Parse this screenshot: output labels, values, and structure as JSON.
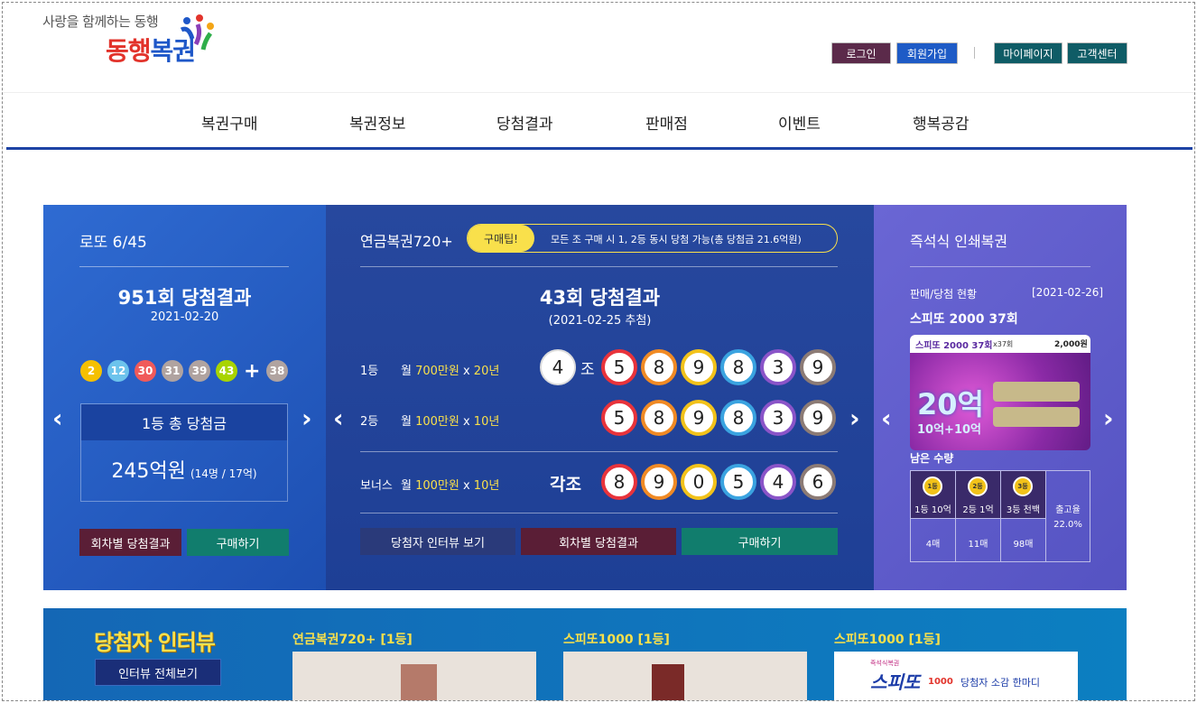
{
  "header": {
    "slogan": "사랑을 함께하는 동행",
    "logo_a": "동행",
    "logo_b": "복권",
    "buttons": [
      {
        "label": "로그인",
        "color": "#5b2a4a"
      },
      {
        "label": "회원가입",
        "color": "#1e5bc6"
      },
      {
        "label": "마이페이지",
        "color": "#0f5c66"
      },
      {
        "label": "고객센터",
        "color": "#0f5c66"
      }
    ]
  },
  "nav": [
    "복권구매",
    "복권정보",
    "당첨결과",
    "판매점",
    "이벤트",
    "행복공감"
  ],
  "lotto": {
    "title": "로또 6/45",
    "round": "951회 당첨결과",
    "date": "2021-02-20",
    "balls": [
      {
        "n": "2",
        "c": "#f5c000"
      },
      {
        "n": "12",
        "c": "#6cc3ec"
      },
      {
        "n": "30",
        "c": "#f05a5a"
      },
      {
        "n": "31",
        "c": "#b0a3a0"
      },
      {
        "n": "39",
        "c": "#b0a3a0"
      },
      {
        "n": "43",
        "c": "#a8d400"
      }
    ],
    "plus": "+",
    "bonus": {
      "n": "38",
      "c": "#b0a3a0"
    },
    "prize_label": "1등 총 당첨금",
    "prize": "245억원",
    "prize_sub": "(14명 / 17억)",
    "btn_results": "회차별 당첨결과",
    "btn_buy": "구매하기"
  },
  "pension": {
    "title": "연금복권720+",
    "tip_label": "구매팁!",
    "tip_text": "모든 조 구매 시 1, 2등 동시 당첨 가능(총 당첨금 21.6억원)",
    "round": "43회 당첨결과",
    "date": "(2021-02-25 추첨)",
    "rank1": {
      "label": "1등",
      "pre": "월 ",
      "amt": "700만원",
      "mid": " x ",
      "yrs": "20년"
    },
    "rank2": {
      "label": "2등",
      "pre": "월 ",
      "amt": "100만원",
      "mid": " x ",
      "yrs": "10년"
    },
    "bonus": {
      "label": "보너스",
      "pre": "월 ",
      "amt": "100만원",
      "mid": " x ",
      "yrs": "10년"
    },
    "group": "4",
    "group_suffix": "조",
    "each_group": "각조",
    "numbers1": [
      "5",
      "8",
      "9",
      "8",
      "3",
      "9"
    ],
    "numbers2": [
      "5",
      "8",
      "9",
      "8",
      "3",
      "9"
    ],
    "numbers3": [
      "8",
      "9",
      "0",
      "5",
      "4",
      "6"
    ],
    "ring_colors": [
      "#e8333b",
      "#f08a24",
      "#f2c21a",
      "#3aa3e0",
      "#8a54c8",
      "#8c7b75"
    ],
    "btn_interview": "당첨자 인터뷰 보기",
    "btn_results": "회차별 당첨결과",
    "btn_buy": "구매하기"
  },
  "instant": {
    "title": "즉석식 인쇄복권",
    "status": "판매/당첨 현황",
    "date": "[2021-02-26]",
    "game": "스피또 2000 37회",
    "card_round": "x37회",
    "card_price": "2,000원",
    "card_big": "20억",
    "card_sub": "10억+10억",
    "remain": "남은 수량",
    "cols": [
      {
        "medal": "1등",
        "label": "1등 10억",
        "count": "4매"
      },
      {
        "medal": "2등",
        "label": "2등 1억",
        "count": "11매"
      },
      {
        "medal": "3등",
        "label": "3등 천백",
        "count": "98매"
      }
    ],
    "rate_label": "출고율",
    "rate": "22.0%"
  },
  "interview": {
    "title": "당첨자 인터뷰",
    "btn": "인터뷰 전체보기",
    "items": [
      "연금복권720+ [1등]",
      "스피또1000 [1등]",
      "스피또1000 [1등]"
    ],
    "spitto_logo": "스피또",
    "spitto_num": "1000",
    "spitto_caption": "당첨자 소감 한마디",
    "spitto_small": "즉석식복권"
  },
  "colors": {
    "accent": "#1d43a5",
    "yellow": "#f9e04b",
    "teal": "#117d6d",
    "maroon": "#5a1e36"
  }
}
